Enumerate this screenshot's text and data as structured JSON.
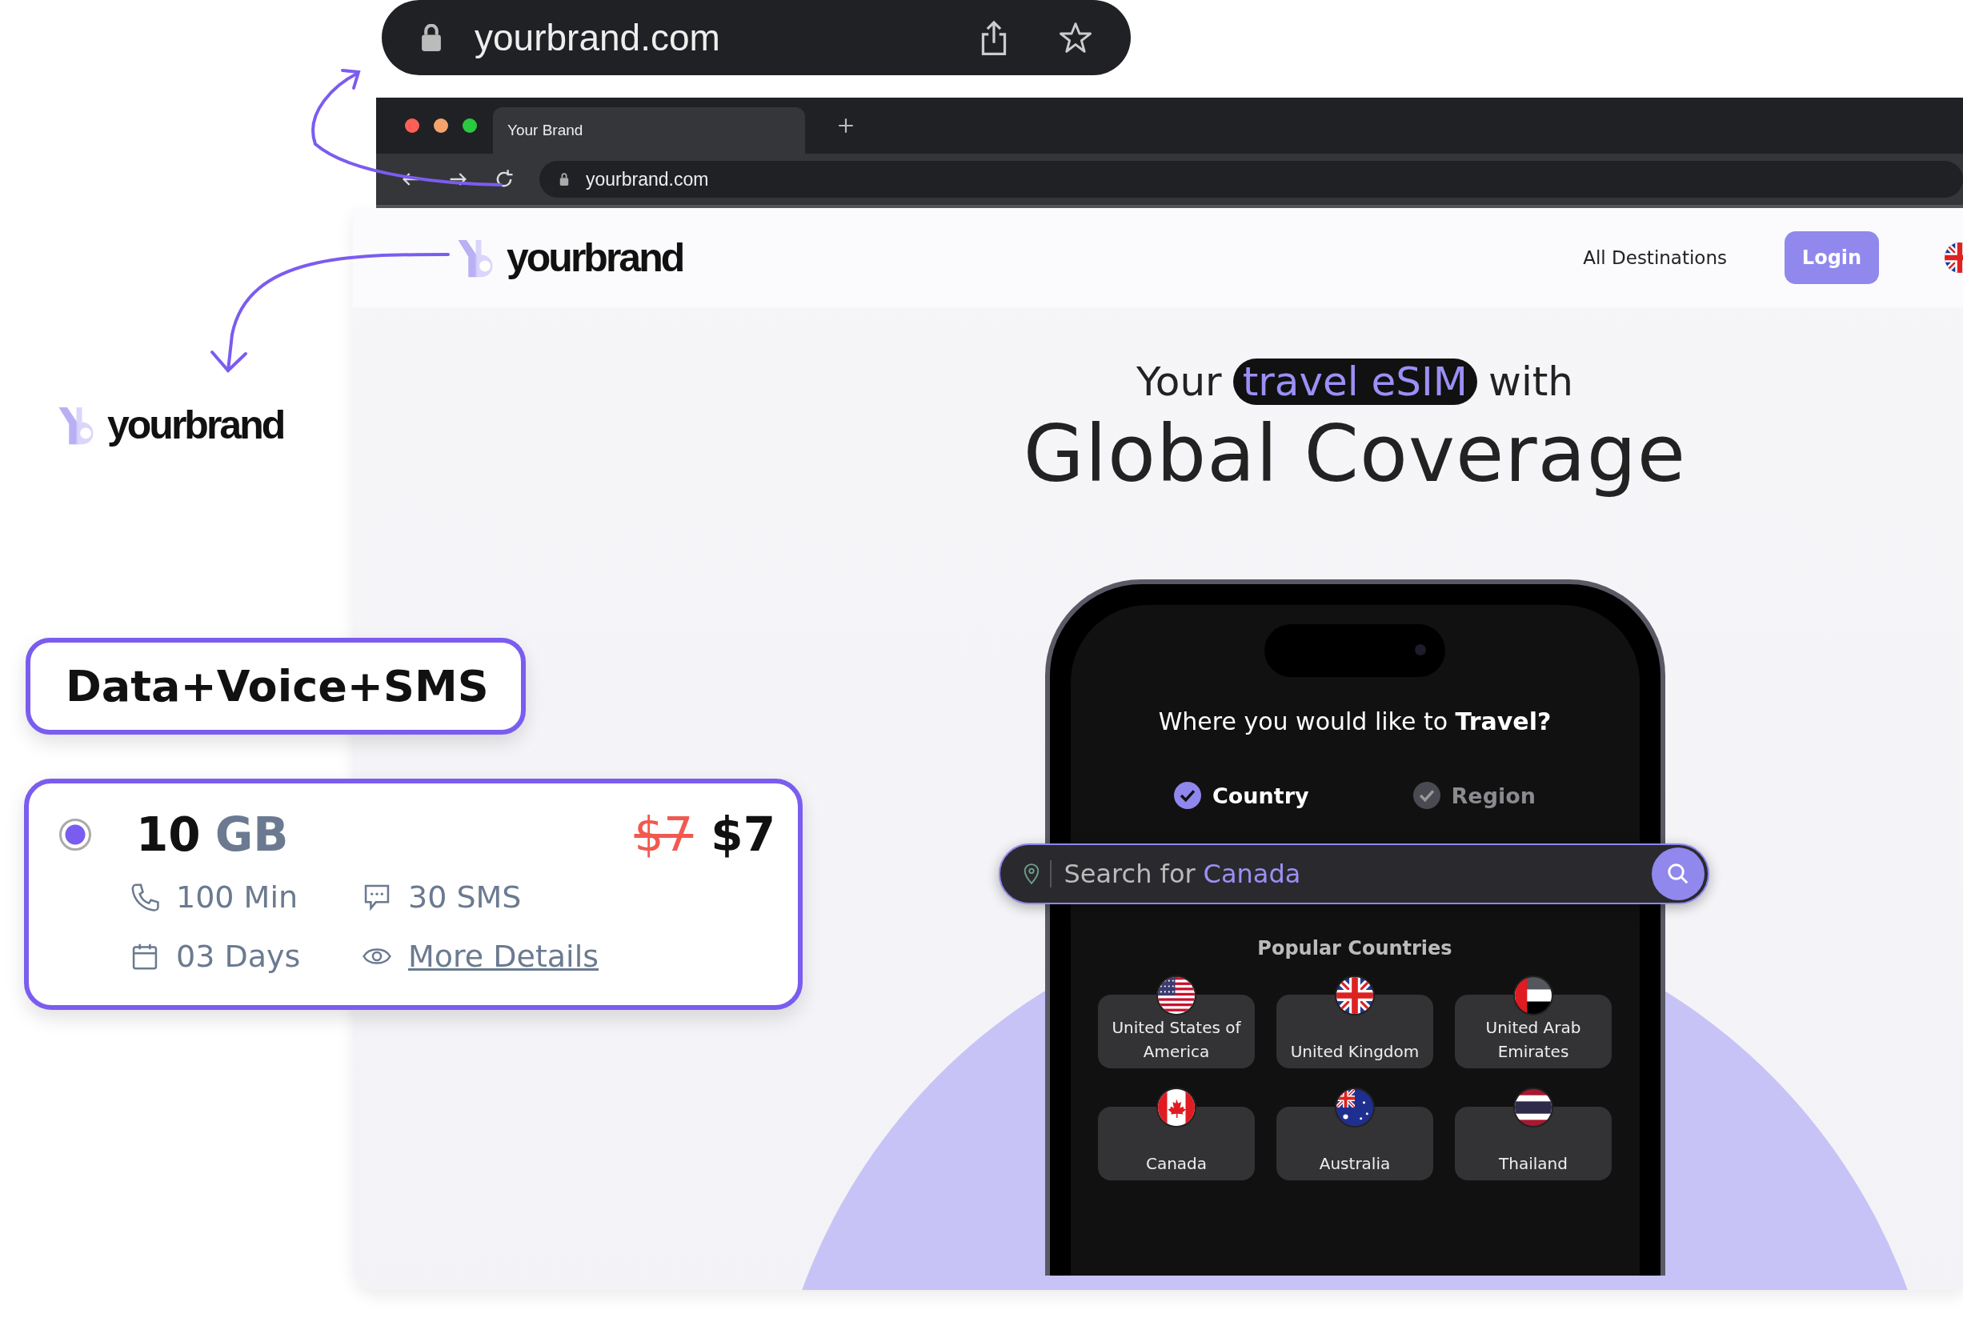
{
  "url_callout": {
    "url": "yourbrand.com"
  },
  "browser": {
    "tab_title": "Your Brand",
    "address": "yourbrand.com"
  },
  "nav": {
    "brand": "yourbrand",
    "links": [
      "All Destinations"
    ],
    "login": "Login"
  },
  "hero": {
    "title_before": "Your",
    "title_highlight": "travel eSIM",
    "title_after": "with",
    "headline": "Global Coverage"
  },
  "phone": {
    "question": "Where you would like to **Travel?**",
    "tabs": [
      {
        "label": "Country",
        "selected": true
      },
      {
        "label": "Region",
        "selected": false
      }
    ],
    "search": {
      "placeholder": "Search for",
      "highlight": "Canada"
    },
    "popular_title": "Popular Countries",
    "countries": [
      {
        "name": "United States of America",
        "kind": "us"
      },
      {
        "name": "United Kingdom",
        "kind": "uk"
      },
      {
        "name": "United Arab Emirates",
        "kind": "ae"
      },
      {
        "name": "Canada",
        "kind": "ca"
      },
      {
        "name": "Australia",
        "kind": "au"
      },
      {
        "name": "Thailand",
        "kind": "th"
      }
    ]
  },
  "side_logo": {
    "brand": "yourbrand"
  },
  "badge": "Data+Voice+SMS",
  "plan": {
    "selected": true,
    "data_amount": "10",
    "data_unit": "GB",
    "old_price": "$7",
    "price": "$7",
    "minutes": "100 Min",
    "sms": "30 SMS",
    "validity": "03 Days",
    "details_link": "More Details"
  }
}
